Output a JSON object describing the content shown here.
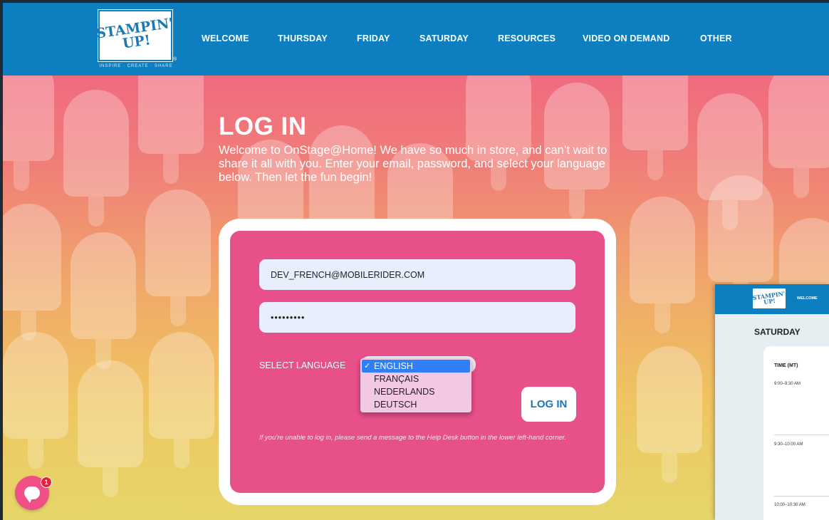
{
  "header": {
    "logo_text": "STAMPIN' UP!",
    "logo_reg": "®",
    "logo_tagline": "INSPIRE · CREATE · SHARE",
    "nav": [
      "WELCOME",
      "THURSDAY",
      "FRIDAY",
      "SATURDAY",
      "RESOURCES",
      "VIDEO ON DEMAND",
      "OTHER"
    ]
  },
  "main": {
    "title": "LOG IN",
    "intro": "Welcome to OnStage@Home! We have so much in store, and can’t wait to share it all with you. Enter your email, password, and select your language below. Then let the fun begin!"
  },
  "form": {
    "email_value": "DEV_FRENCH@MOBILERIDER.COM",
    "password_value": "•••••••••",
    "language_label": "SELECT LANGUAGE",
    "selected_language": "ENGLISH",
    "language_options": [
      "ENGLISH",
      "FRANÇAIS",
      "NEDERLANDS",
      "DEUTSCH"
    ],
    "check_mark": "✓",
    "login_button": "LOG IN",
    "help_text": "If you’re unable to log in, please send a message to the Help Desk button in the lower left-hand corner."
  },
  "chat": {
    "badge_count": "1"
  },
  "preview": {
    "logo_text": "STAMPIN' UP!",
    "nav_item": "WELCOME",
    "day": "SATURDAY",
    "col_header": "TIME (MT)",
    "times": [
      "9:00–9:30 AM",
      "9:30–10:00 AM",
      "10:00–10:30 AM"
    ]
  },
  "colors": {
    "header_blue": "#0d7fc0",
    "card_pink": "#e8508a",
    "button_text": "#1a77b5"
  }
}
